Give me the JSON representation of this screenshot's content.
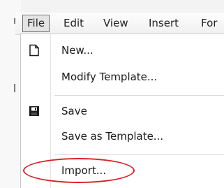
{
  "menubar": {
    "items": [
      {
        "label": "File"
      },
      {
        "label": "Edit"
      },
      {
        "label": "View"
      },
      {
        "label": "Insert"
      },
      {
        "label": "For"
      }
    ]
  },
  "file_menu": {
    "items": [
      {
        "label": "New...",
        "icon": "new-document-icon"
      },
      {
        "label": "Modify Template..."
      },
      {
        "label": "Save",
        "icon": "save-icon"
      },
      {
        "label": "Save as Template..."
      },
      {
        "label": "Import..."
      }
    ]
  },
  "colors": {
    "highlight_ellipse": "#d8232a",
    "menu_background": "#ffffff",
    "menubar_background": "#f0f0f0"
  }
}
